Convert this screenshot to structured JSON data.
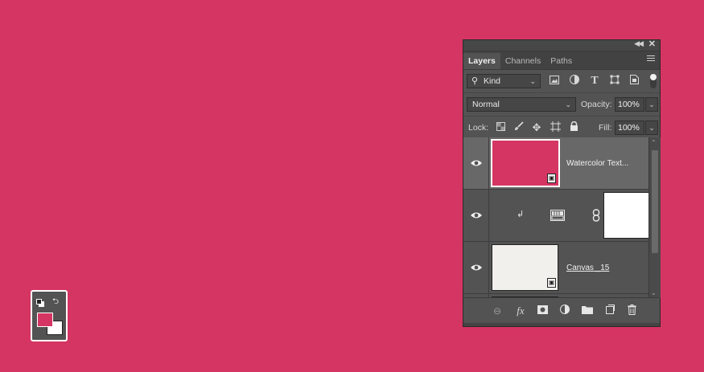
{
  "panel": {
    "tabs": [
      {
        "label": "Layers"
      },
      {
        "label": "Channels"
      },
      {
        "label": "Paths"
      }
    ],
    "filter": {
      "kind_label": "Kind"
    },
    "blend": {
      "mode": "Normal",
      "opacity_label": "Opacity:",
      "opacity_value": "100%"
    },
    "lock": {
      "label": "Lock:",
      "fill_label": "Fill:",
      "fill_value": "100%"
    },
    "layers": [
      {
        "name": "Watercolor Text...",
        "thumb_color": "#d53562",
        "selected": true
      },
      {
        "name": "",
        "type": "adjustment-gradient-map"
      },
      {
        "name": "Canvas _15",
        "thumb_color": "#f2f0ec"
      }
    ]
  },
  "swatch": {
    "foreground": "#d53562",
    "background": "#ffffff"
  },
  "colors": {
    "canvas": "#d53562",
    "panel": "#535353"
  }
}
